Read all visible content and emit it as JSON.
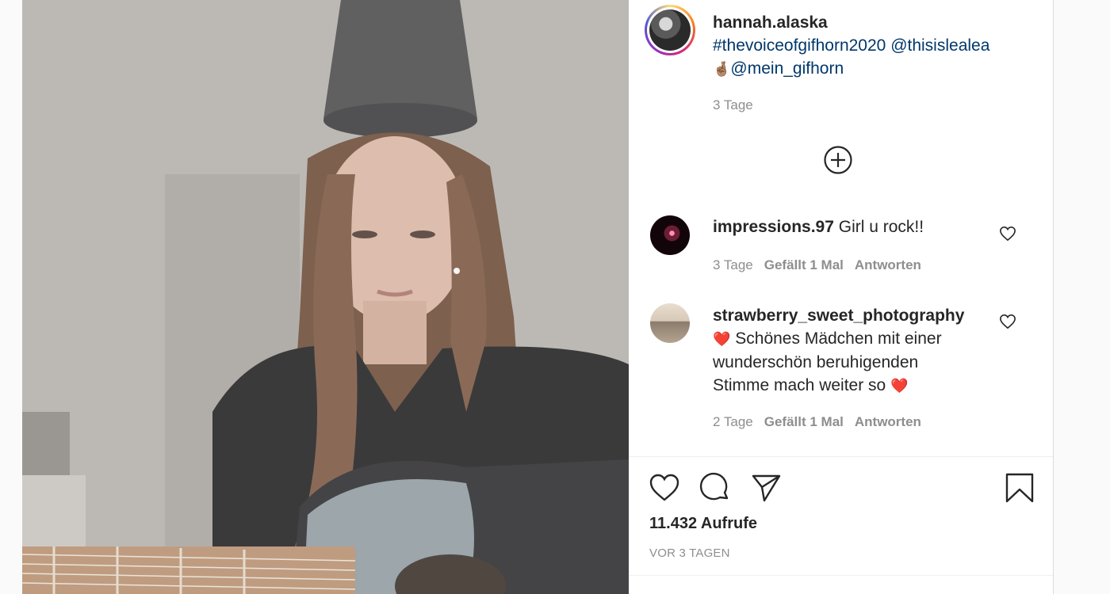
{
  "post": {
    "author": "hannah.alaska",
    "caption_hashtag": "#thevoiceofgifhorn2020",
    "caption_mention1": "@thisislealea",
    "caption_emoji": "🤞🏽",
    "caption_mention2": "@mein_gifhorn",
    "caption_time": "3 Tage"
  },
  "load_more": {
    "icon": "plus-circle-icon"
  },
  "comments": [
    {
      "username": "impressions.97",
      "text": "Girl u rock!!",
      "time": "3 Tage",
      "likes": "Gefällt 1 Mal",
      "reply": "Antworten"
    },
    {
      "username": "strawberry_sweet_photography",
      "text_line1": "Schönes Mädchen mit einer",
      "text_line2": "wunderschön beruhigenden",
      "text_line3": "Stimme mach weiter so",
      "emoji": "❤️",
      "time": "2 Tage",
      "likes": "Gefällt 1 Mal",
      "reply": "Antworten"
    }
  ],
  "stats": {
    "views": "11.432 Aufrufe",
    "date": "VOR 3 TAGEN"
  }
}
